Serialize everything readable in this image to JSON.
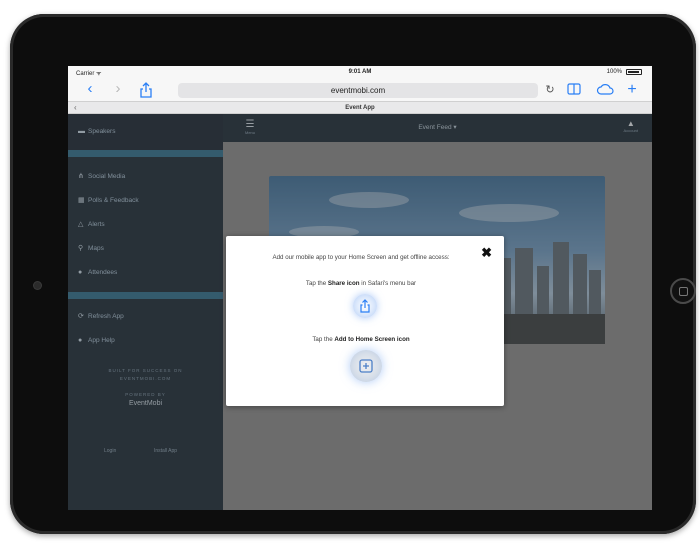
{
  "status_bar": {
    "carrier": "Carrier ᯤ",
    "time": "9:01 AM",
    "battery": "100%"
  },
  "browser": {
    "url": "eventmobi.com",
    "tab_title": "Event App",
    "back_label": "‹",
    "forward_label": "›",
    "back_tab_label": "‹"
  },
  "sidebar": {
    "items_top": [
      {
        "label": "Speakers",
        "icon": "flag-icon"
      },
      {
        "label": "Social Media",
        "icon": "share-icon"
      },
      {
        "label": "Polls & Feedback",
        "icon": "chart-icon"
      },
      {
        "label": "Alerts",
        "icon": "bell-icon"
      },
      {
        "label": "Maps",
        "icon": "pin-icon"
      },
      {
        "label": "Attendees",
        "icon": "people-icon"
      }
    ],
    "items_bottom": [
      {
        "label": "Refresh App",
        "icon": "refresh-icon"
      },
      {
        "label": "App Help",
        "icon": "help-icon"
      }
    ],
    "small_text_1": "BUILT FOR SUCCESS ON",
    "small_text_2": "EVENTMOBI.COM",
    "powered_by": "POWERED BY",
    "brand": "EventMobi",
    "footer_left": "Login",
    "footer_right": "Install App"
  },
  "header": {
    "menu_label": "Menu",
    "event_title": "Event Feed ▾",
    "user_label": "Account"
  },
  "modal": {
    "line1": "Add our mobile app to your Home Screen and get offline access:",
    "share_prefix": "Tap the ",
    "share_bold": "Share icon",
    "share_suffix": " in Safari's menu bar",
    "add_prefix": "Tap the ",
    "add_bold": "Add to Home Screen icon",
    "close_symbol": "✖"
  },
  "colors": {
    "sidebar_bg": "#1c2a36",
    "accent_divider": "#2f6e8c",
    "safari_blue": "#2a7ff5"
  }
}
